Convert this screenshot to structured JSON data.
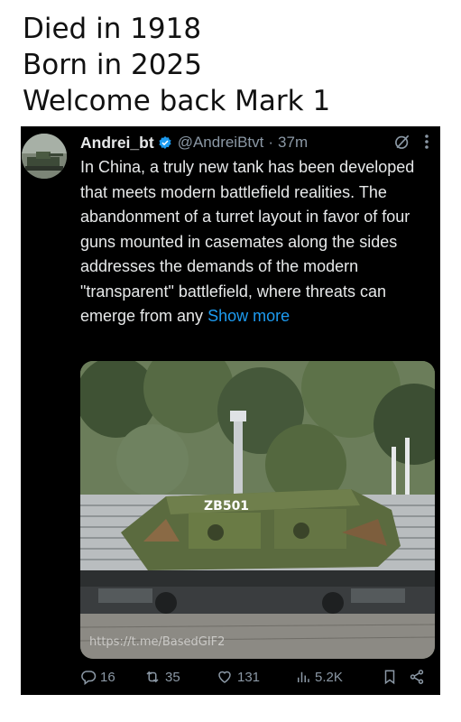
{
  "caption": {
    "line1": "Died in 1918",
    "line2": "Born in 2025",
    "line3": "Welcome back Mark 1"
  },
  "tweet": {
    "author_name": "Andrei_bt",
    "author_handle": "@AndreiBtvt",
    "separator": "·",
    "time": "37m",
    "body": "In China, a truly new tank has been developed that meets modern battlefield realities. The abandonment of a turret layout in favor of four guns mounted in casemates along the sides addresses the demands of the modern \"transparent\" battlefield, where threats can emerge from any",
    "show_more": "Show more",
    "media": {
      "vehicle_number": "ZB501",
      "watermark": "https://t.me/BasedGIF2"
    },
    "stats": {
      "replies": "16",
      "reposts": "35",
      "likes": "131",
      "views": "5.2K"
    }
  },
  "colors": {
    "tweet_bg": "#000000",
    "text": "#e7e9ea",
    "muted": "#8b98a5",
    "link": "#1d9bf0",
    "verified": "#1d9bf0"
  }
}
